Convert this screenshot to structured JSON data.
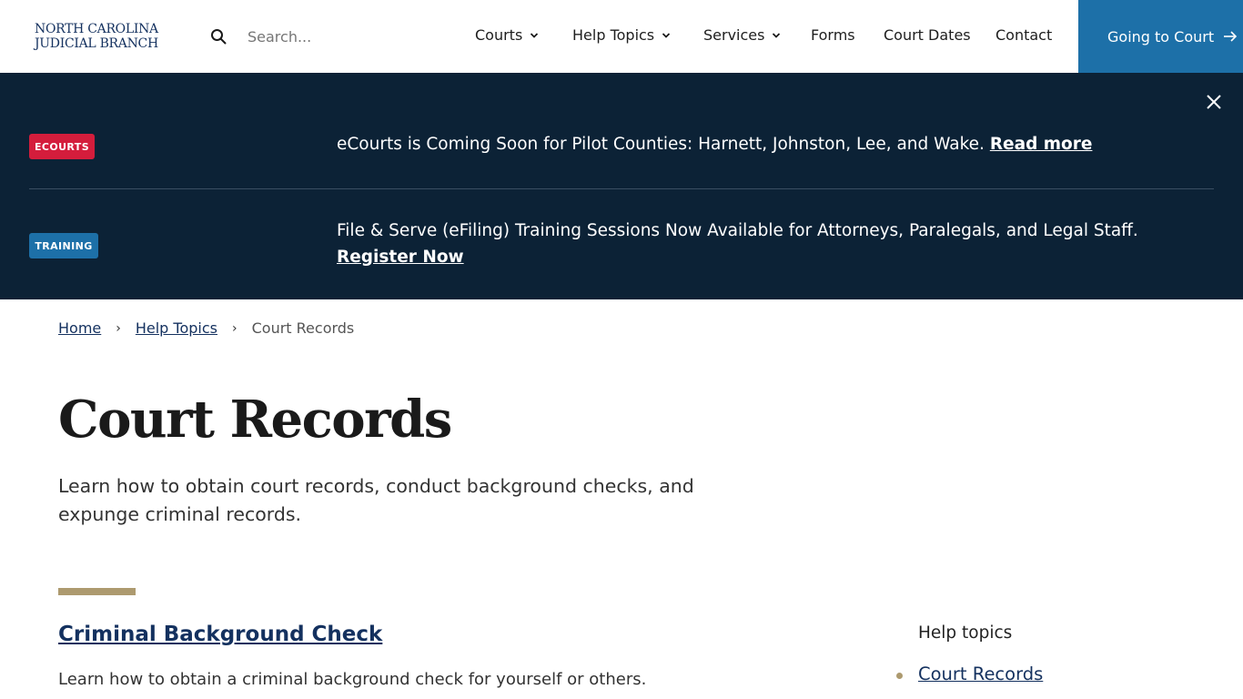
{
  "header": {
    "logo_line1": "NORTH CAROLINA",
    "logo_line2": "JUDICIAL BRANCH",
    "search_placeholder": "Search...",
    "nav": [
      {
        "label": "Courts"
      },
      {
        "label": "Help Topics"
      },
      {
        "label": "Services"
      },
      {
        "label": "Forms"
      },
      {
        "label": "Court Dates"
      },
      {
        "label": "Contact"
      }
    ],
    "cta_label": "Going to Court"
  },
  "alerts": [
    {
      "badge": "ECOURTS",
      "text": "eCourts is Coming Soon for Pilot Counties: Harnett, Johnston, Lee, and Wake.",
      "link": "Read more"
    },
    {
      "badge": "TRAINING",
      "text": "File & Serve (eFiling) Training Sessions Now Available for Attorneys, Paralegals, and Legal Staff.",
      "link": "Register Now"
    }
  ],
  "breadcrumb": {
    "items": [
      "Home",
      "Help Topics"
    ],
    "current": "Court Records"
  },
  "main": {
    "title": "Court Records",
    "intro": "Learn how to obtain court records, conduct background checks, and expunge criminal records.",
    "card_title": "Criminal Background Check",
    "card_desc": "Learn how to obtain a criminal background check for yourself or others."
  },
  "sidebar": {
    "heading": "Help topics",
    "link": "Court Records"
  },
  "colors": {
    "navy": "#14315f",
    "banner_bg": "#0c2236",
    "cta_blue": "#1d70a8",
    "badge_red": "#d41d3c",
    "gold": "#ad9a6f"
  },
  "icons": [
    "search-icon",
    "chevron-down-icon",
    "arrow-right-icon",
    "close-icon"
  ]
}
